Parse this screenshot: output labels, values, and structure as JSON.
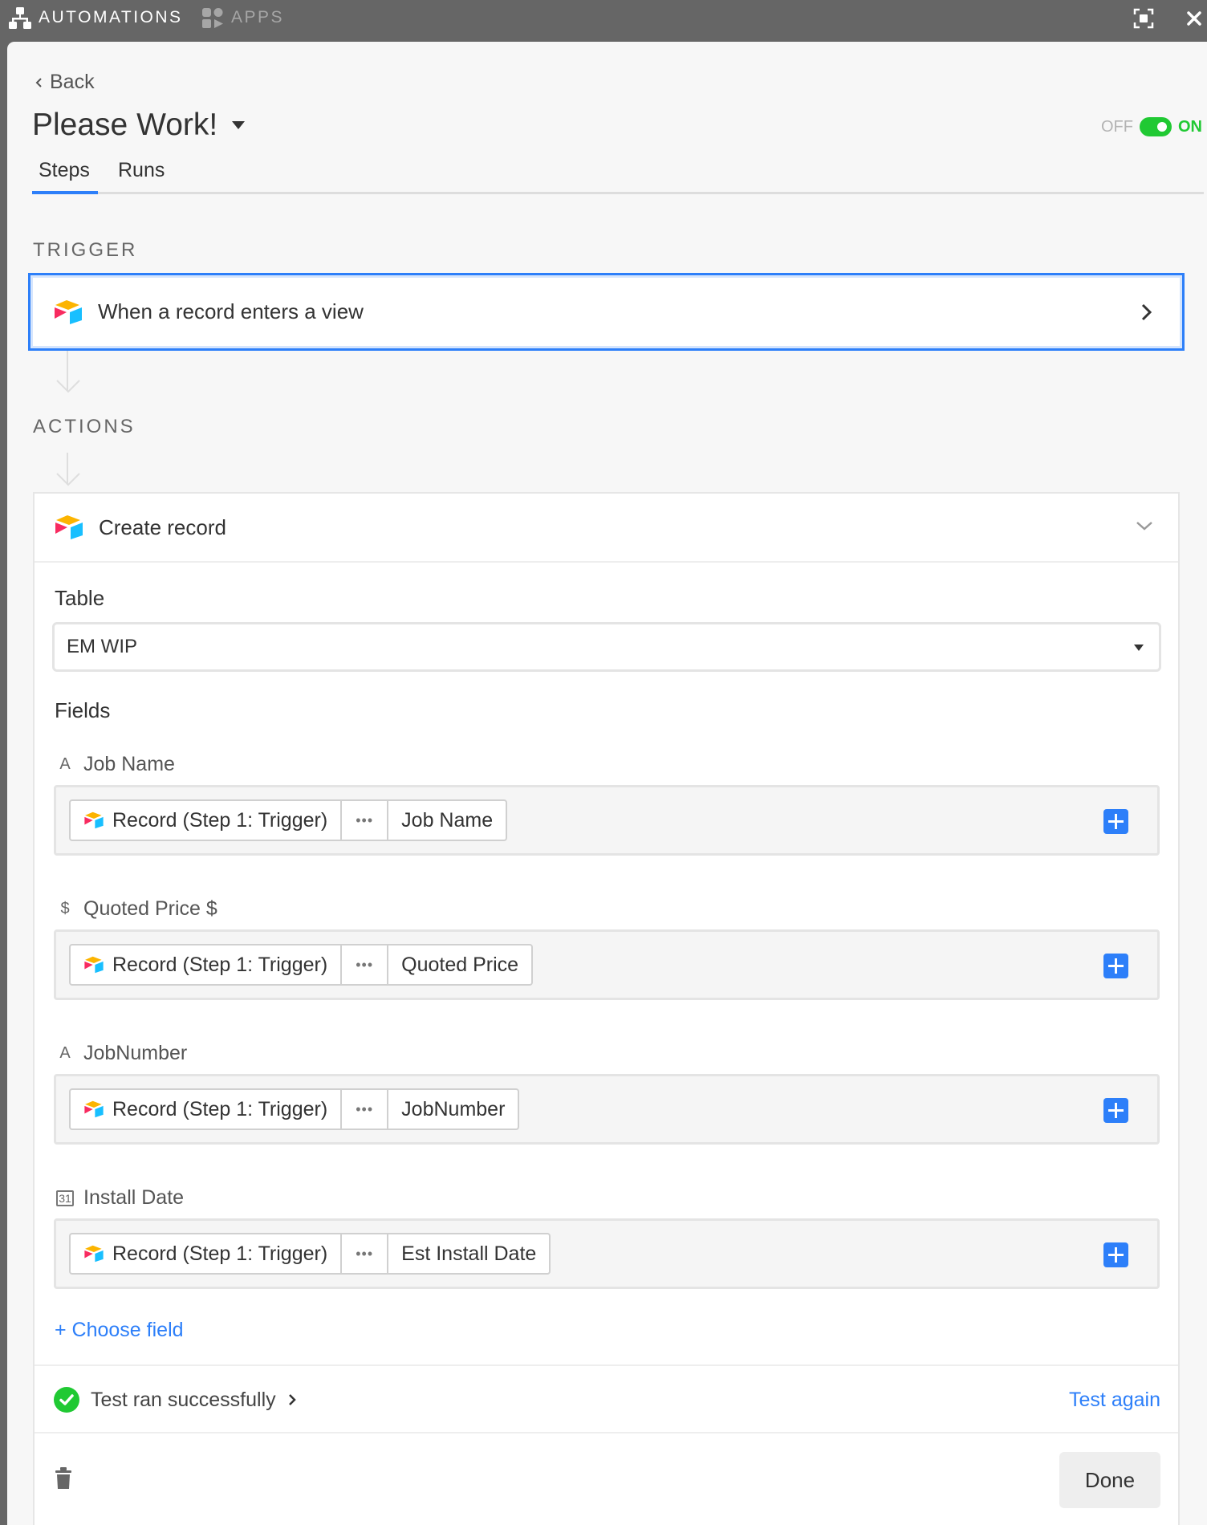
{
  "topbar": {
    "automations_label": "AUTOMATIONS",
    "apps_label": "APPS"
  },
  "header": {
    "back_label": "Back",
    "title": "Please Work!",
    "toggle": {
      "off_label": "OFF",
      "on_label": "ON",
      "state": "on"
    },
    "tabs": [
      {
        "label": "Steps",
        "active": true
      },
      {
        "label": "Runs",
        "active": false
      }
    ]
  },
  "trigger": {
    "section_label": "TRIGGER",
    "label": "When a record enters a view"
  },
  "actions": {
    "section_label": "ACTIONS",
    "action": {
      "title": "Create record",
      "table_label": "Table",
      "table_value": "EM WIP",
      "fields_label": "Fields",
      "fields": [
        {
          "type_icon": "A",
          "name": "Job Name",
          "source": "Record (Step 1: Trigger)",
          "dots": "•••",
          "value": "Job Name"
        },
        {
          "type_icon": "$",
          "name": "Quoted Price $",
          "source": "Record (Step 1: Trigger)",
          "dots": "•••",
          "value": "Quoted Price"
        },
        {
          "type_icon": "A",
          "name": "JobNumber",
          "source": "Record (Step 1: Trigger)",
          "dots": "•••",
          "value": "JobNumber"
        },
        {
          "type_icon": "31",
          "name": "Install Date",
          "source": "Record (Step 1: Trigger)",
          "dots": "•••",
          "value": "Est Install Date"
        }
      ],
      "choose_field_label": "+ Choose field",
      "test_status": "Test ran successfully",
      "test_again_label": "Test again",
      "done_label": "Done"
    }
  },
  "colors": {
    "accent": "#2d7ff9",
    "success": "#20c933",
    "topbar": "#666666"
  }
}
